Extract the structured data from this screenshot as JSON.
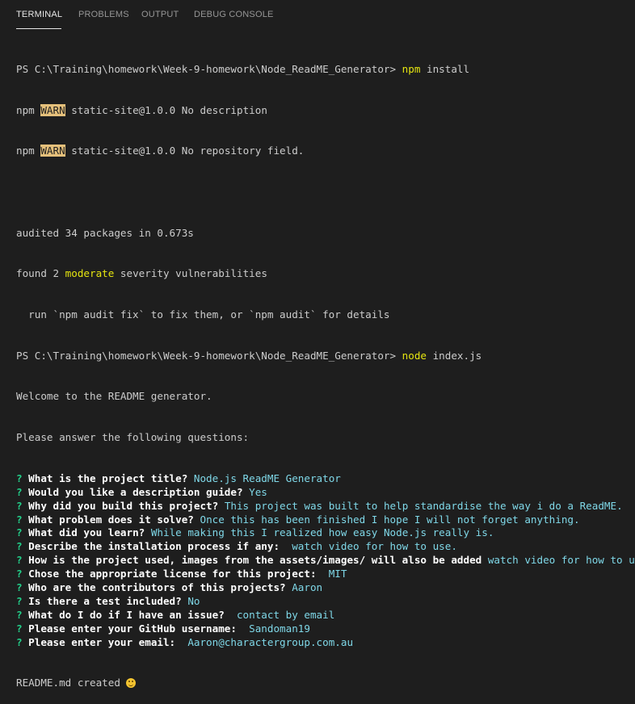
{
  "tabs": [
    {
      "label": "TERMINAL"
    },
    {
      "label": "PROBLEMS"
    },
    {
      "label": "OUTPUT"
    },
    {
      "label": "DEBUG CONSOLE"
    }
  ],
  "terminal": {
    "prompt1": "PS C:\\Training\\homework\\Week-9-homework\\Node_ReadME_Generator> ",
    "cmd1_name": "npm",
    "cmd1_args": " install",
    "warn_prefix": "npm ",
    "warn_tag": "WARN",
    "warn1_text": " static-site@1.0.0 No description",
    "warn2_text": " static-site@1.0.0 No repository field.",
    "audited": "audited 34 packages in 0.673s",
    "found_prefix": "found 2 ",
    "found_moderate": "moderate",
    "found_suffix": " severity vulnerabilities",
    "fix_hint": "  run `npm audit fix` to fix them, or `npm audit` for details",
    "prompt2": "PS C:\\Training\\homework\\Week-9-homework\\Node_ReadME_Generator> ",
    "cmd2_name": "node",
    "cmd2_args": " index.js",
    "welcome": "Welcome to the README generator.",
    "please": "Please answer the following questions:",
    "qmark": "? ",
    "questions": [
      {
        "q": "What is the project title? ",
        "a": "Node.js ReadME Generator"
      },
      {
        "q": "Would you like a description guide? ",
        "a": "Yes"
      },
      {
        "q": "Why did you build this project? ",
        "a": "This project was built to help standardise the way i do a ReadME."
      },
      {
        "q": "What problem does it solve? ",
        "a": "Once this has been finished I hope I will not forget anything."
      },
      {
        "q": "What did you learn? ",
        "a": "While making this I realized how easy Node.js really is."
      },
      {
        "q": "Describe the installation process if any:  ",
        "a": "watch video for how to use."
      },
      {
        "q": "How is the project used, images from the assets/images/ will also be added ",
        "a": "watch video for how to use."
      },
      {
        "q": "Chose the appropriate license for this project:  ",
        "a": "MIT"
      },
      {
        "q": "Who are the contributors of this projects? ",
        "a": "Aaron"
      },
      {
        "q": "Is there a test included? ",
        "a": "No"
      },
      {
        "q": "What do I do if I have an issue?  ",
        "a": "contact by email"
      },
      {
        "q": "Please enter your GitHub username:  ",
        "a": "Sandoman19"
      },
      {
        "q": "Please enter your email:  ",
        "a": "Aaron@charactergroup.com.au"
      }
    ],
    "created": "README.md created ",
    "emoji_name": "smiling-face-icon"
  },
  "colors": {
    "background": "#1e1e1e",
    "text": "#cccccc",
    "qmark": "#23d18b",
    "answer": "#7fd8e8",
    "command": "#e5e510",
    "warn_bg": "#e5c07b"
  }
}
